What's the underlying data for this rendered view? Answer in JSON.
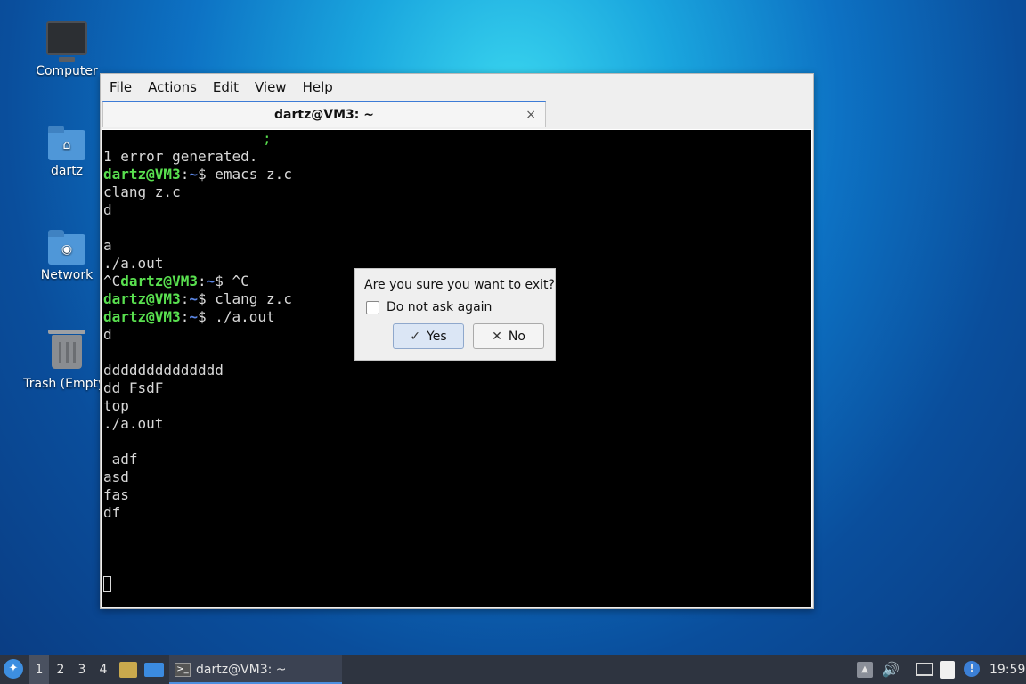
{
  "desktop": {
    "icons": [
      {
        "label": "Computer"
      },
      {
        "label": "dartz"
      },
      {
        "label": "Network"
      },
      {
        "label": "Trash (Empty)"
      }
    ]
  },
  "window": {
    "menu": [
      "File",
      "Actions",
      "Edit",
      "View",
      "Help"
    ],
    "tab_title": "dartz@VM3: ~",
    "tab_close": "×"
  },
  "terminal": {
    "prompt_user": "dartz@VM3",
    "prompt_path": "~",
    "lines": {
      "l0": ";",
      "l1": "1 error generated.",
      "l2_cmd": "$ emacs z.c",
      "l3": "clang z.c",
      "l4": "d",
      "l5": "",
      "l6": "a",
      "l7": "./a.out",
      "l8_pre": "^C",
      "l8_cmd": "$ ^C",
      "l9_cmd": "$ clang z.c",
      "l10_cmd": "$ ./a.out",
      "l11": "d",
      "l12": "",
      "l13": "dddddddddddddd",
      "l14": "dd FsdF",
      "l15": "top",
      "l16": "./a.out",
      "l17": "",
      "l18": " adf",
      "l19": "asd",
      "l20": "fas",
      "l21": "df"
    }
  },
  "dialog": {
    "message": "Are you sure you want to exit?",
    "checkbox_label": "Do not ask again",
    "yes_label": "Yes",
    "no_label": "No",
    "yes_icon": "✓",
    "no_icon": "✕"
  },
  "taskbar": {
    "workspaces": [
      "1",
      "2",
      "3",
      "4"
    ],
    "task_title": "dartz@VM3: ~",
    "clock": "19:59"
  }
}
